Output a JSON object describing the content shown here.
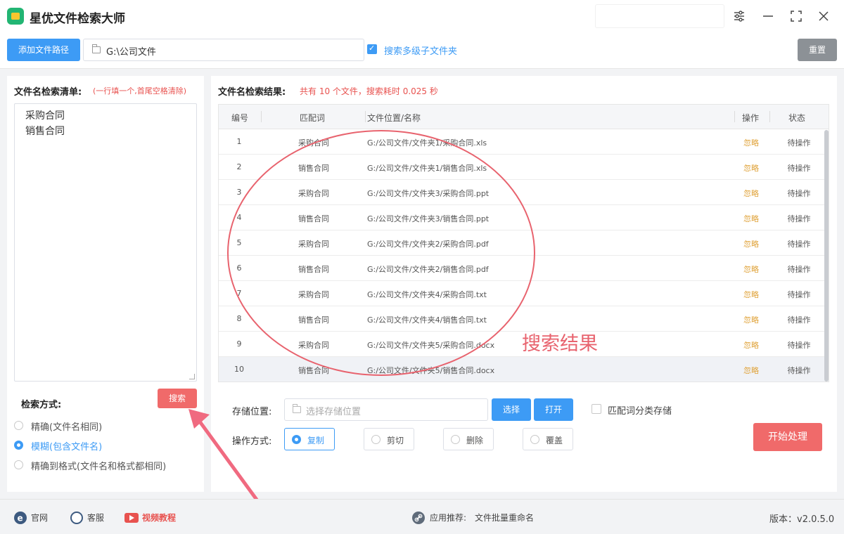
{
  "app": {
    "title": "星优文件检索大师"
  },
  "window_controls": [
    "settings-sliders",
    "minimize",
    "maximize",
    "close"
  ],
  "toolbar": {
    "add_path_label": "添加文件路径",
    "path_value": "G:\\公司文件",
    "subfolder_checked": true,
    "subfolder_label": "搜索多级子文件夹",
    "reset_label": "重置"
  },
  "left": {
    "title": "文件名检索清单:",
    "hint": "(一行填一个,首尾空格清除)",
    "keywords": [
      "采购合同",
      "销售合同"
    ],
    "mode_title": "检索方式:",
    "search_label": "搜索",
    "modes": [
      {
        "label": "精确(文件名相同)",
        "selected": false
      },
      {
        "label": "模糊(包含文件名)",
        "selected": true
      },
      {
        "label": "精确到格式(文件名和格式都相同)",
        "selected": false
      }
    ]
  },
  "results": {
    "title": "文件名检索结果:",
    "summary": "共有 10 个文件，搜索耗时 0.025 秒",
    "columns": [
      "编号",
      "匹配词",
      "文件位置/名称",
      "操作",
      "状态"
    ],
    "rows": [
      {
        "no": "1",
        "keyword": "采购合同",
        "path": "G:/公司文件/文件夹1/采购合同.xls",
        "action": "忽略",
        "status": "待操作"
      },
      {
        "no": "2",
        "keyword": "销售合同",
        "path": "G:/公司文件/文件夹1/销售合同.xls",
        "action": "忽略",
        "status": "待操作"
      },
      {
        "no": "3",
        "keyword": "采购合同",
        "path": "G:/公司文件/文件夹3/采购合同.ppt",
        "action": "忽略",
        "status": "待操作"
      },
      {
        "no": "4",
        "keyword": "销售合同",
        "path": "G:/公司文件/文件夹3/销售合同.ppt",
        "action": "忽略",
        "status": "待操作"
      },
      {
        "no": "5",
        "keyword": "采购合同",
        "path": "G:/公司文件/文件夹2/采购合同.pdf",
        "action": "忽略",
        "status": "待操作"
      },
      {
        "no": "6",
        "keyword": "销售合同",
        "path": "G:/公司文件/文件夹2/销售合同.pdf",
        "action": "忽略",
        "status": "待操作"
      },
      {
        "no": "7",
        "keyword": "采购合同",
        "path": "G:/公司文件/文件夹4/采购合同.txt",
        "action": "忽略",
        "status": "待操作"
      },
      {
        "no": "8",
        "keyword": "销售合同",
        "path": "G:/公司文件/文件夹4/销售合同.txt",
        "action": "忽略",
        "status": "待操作"
      },
      {
        "no": "9",
        "keyword": "采购合同",
        "path": "G:/公司文件/文件夹5/采购合同.docx",
        "action": "忽略",
        "status": "待操作"
      },
      {
        "no": "10",
        "keyword": "销售合同",
        "path": "G:/公司文件/文件夹5/销售合同.docx",
        "action": "忽略",
        "status": "待操作"
      }
    ],
    "annotation_label": "搜索结果"
  },
  "storage": {
    "label": "存储位置:",
    "placeholder": "选择存储位置",
    "choose_label": "选择",
    "open_label": "打开",
    "classify_checked": false,
    "classify_label": "匹配词分类存储"
  },
  "operation": {
    "label": "操作方式:",
    "options": [
      {
        "label": "复制",
        "selected": true
      },
      {
        "label": "剪切",
        "selected": false
      },
      {
        "label": "删除",
        "selected": false
      },
      {
        "label": "覆盖",
        "selected": false
      }
    ],
    "start_label": "开始处理"
  },
  "footer": {
    "website": "官网",
    "support": "客服",
    "video": "视频教程",
    "recommend_label": "应用推荐:",
    "recommend_app": "文件批量重命名",
    "version": "版本：v2.0.5.0"
  },
  "colors": {
    "accent": "#3d9bf5",
    "danger": "#f06a6a",
    "hint_red": "#e8524f",
    "annotation": "#e8636e",
    "ignore_action": "#e0a33a"
  }
}
